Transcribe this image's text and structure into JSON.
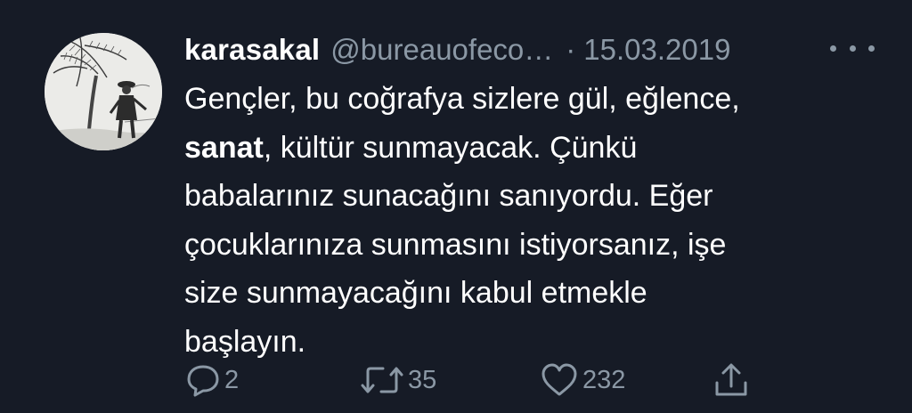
{
  "tweet": {
    "display_name": "karasakal",
    "handle": "@bureauofeco…",
    "separator": "·",
    "date": "15.03.2019",
    "text": {
      "line1": "Gençler, bu coğrafya sizlere gül, eğlence,",
      "line2_bold": "sanat",
      "line2_rest": ", kültür sunmayacak. Çünkü",
      "line3": "babalarınız sunacağını sanıyordu. Eğer",
      "line4": "çocuklarınıza sunmasını istiyorsanız, işe",
      "line5": "size sunmayacağını kabul etmekle",
      "line6": "başlayın."
    },
    "actions": {
      "replies": "2",
      "retweets": "35",
      "likes": "232"
    }
  },
  "colors": {
    "background": "#161b26",
    "text": "#ffffff",
    "muted": "#8b98a5"
  },
  "icons": {
    "more": "more-dots-icon",
    "reply": "reply-bubble-icon",
    "retweet": "retweet-icon",
    "like": "heart-icon",
    "share": "share-icon"
  }
}
